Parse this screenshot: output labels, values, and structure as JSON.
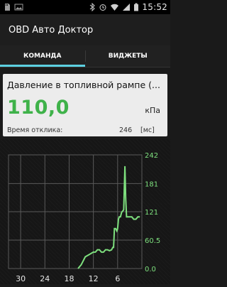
{
  "status_bar": {
    "time": "15:52",
    "left_icons": [
      "sd-card-icon",
      "image-icon"
    ],
    "right_icons": [
      "bluetooth-icon",
      "alarm-icon",
      "wifi-icon",
      "signal-icon",
      "battery-icon"
    ]
  },
  "app": {
    "title": "OBD Авто Доктор"
  },
  "tabs": [
    {
      "label": "КОМАНДА",
      "active": true
    },
    {
      "label": "ВИДЖЕТЫ",
      "active": false
    }
  ],
  "sensor": {
    "title": "Давление в топливной рампе (...",
    "value": "110,0",
    "unit": "кПа",
    "latency_label": "Время отклика:",
    "latency_value": "246",
    "latency_unit": "[мс]"
  },
  "colors": {
    "accent_tab": "#5cd0e0",
    "value_green": "#3fb24a",
    "chart_line": "#7ee07e",
    "grid": "#5a5a5a"
  },
  "chart_data": {
    "type": "line",
    "x_tick_labels": [
      "30",
      "24",
      "18",
      "12",
      "6"
    ],
    "x_ticks": [
      30,
      24,
      18,
      12,
      6
    ],
    "xlim": [
      0,
      33
    ],
    "y_tick_labels": [
      "242",
      "181",
      "121",
      "60.5",
      "0.0"
    ],
    "y_ticks": [
      242,
      181,
      121,
      60.5,
      0
    ],
    "ylim": [
      0,
      242
    ],
    "series": [
      {
        "x": [
          15.8,
          15.0,
          14.0,
          13.0,
          12.0,
          11.5,
          11.0,
          10.5,
          10.0,
          9.5,
          9.0,
          8.5,
          8.0,
          7.5,
          7.2,
          7.0,
          6.8,
          6.5,
          6.2,
          6.0,
          5.8,
          5.6,
          5.3,
          5.0,
          4.5,
          4.2,
          4.0,
          3.8,
          3.5,
          3.0,
          2.5,
          2.0,
          1.5,
          1.0,
          0.5
        ],
        "y": [
          0,
          8,
          25,
          30,
          35,
          35,
          40,
          40,
          35,
          35,
          40,
          40,
          38,
          40,
          45,
          45,
          85,
          85,
          80,
          85,
          105,
          110,
          110,
          120,
          125,
          218,
          150,
          110,
          110,
          110,
          110,
          105,
          105,
          110,
          110
        ]
      }
    ]
  }
}
